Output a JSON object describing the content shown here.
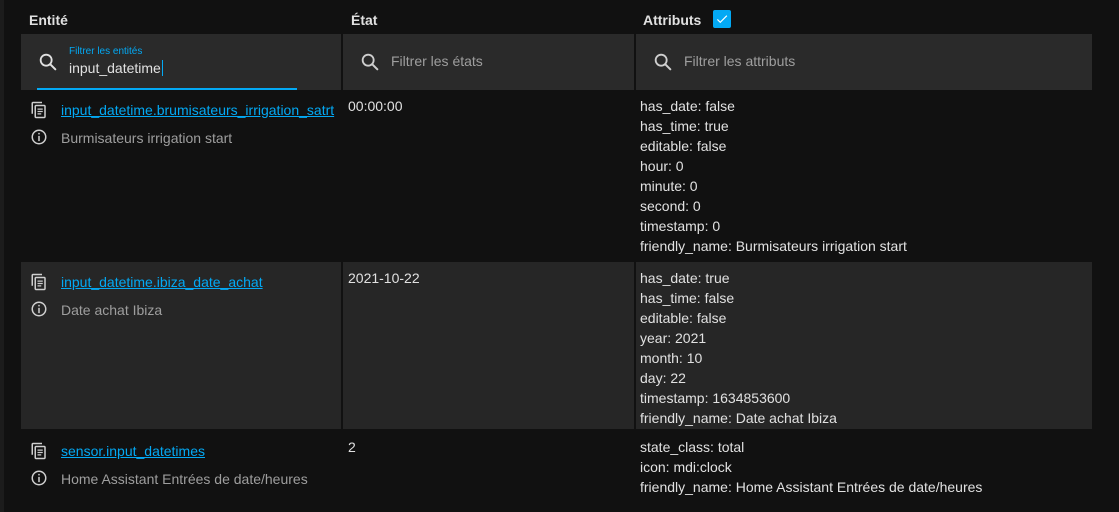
{
  "header": {
    "entity": "Entité",
    "state": "État",
    "attributes": "Attributs",
    "attributes_checked": true
  },
  "filters": {
    "entity_label": "Filtrer les entités",
    "entity_value": "input_datetime",
    "state_placeholder": "Filtrer les états",
    "attributes_placeholder": "Filtrer les attributs"
  },
  "rows": [
    {
      "entity_id": "input_datetime.brumisateurs_irrigation_satrt",
      "friendly_name": "Burmisateurs irrigation start",
      "state": "00:00:00",
      "attributes": [
        "has_date: false",
        "has_time: true",
        "editable: false",
        "hour: 0",
        "minute: 0",
        "second: 0",
        "timestamp: 0",
        "friendly_name: Burmisateurs irrigation start"
      ]
    },
    {
      "entity_id": "input_datetime.ibiza_date_achat",
      "friendly_name": "Date achat Ibiza",
      "state": "2021-10-22",
      "attributes": [
        "has_date: true",
        "has_time: false",
        "editable: false",
        "year: 2021",
        "month: 10",
        "day: 22",
        "timestamp: 1634853600",
        "friendly_name: Date achat Ibiza"
      ]
    },
    {
      "entity_id": "sensor.input_datetimes",
      "friendly_name": "Home Assistant Entrées de date/heures",
      "state": "2",
      "attributes": [
        "state_class: total",
        "icon: mdi:clock",
        "friendly_name: Home Assistant Entrées de date/heures"
      ]
    }
  ],
  "colors": {
    "accent": "#03a9f4",
    "background": "#111111",
    "cell_shade": "#262626",
    "filter_bg": "#2a2a2a",
    "text": "#e1e1e1",
    "muted_text": "#9e9e9e"
  },
  "icons": {
    "search": "search-icon",
    "copy": "clipboard-copy-icon",
    "info": "info-circle-icon",
    "checkbox": "checkbox-checked-icon"
  }
}
